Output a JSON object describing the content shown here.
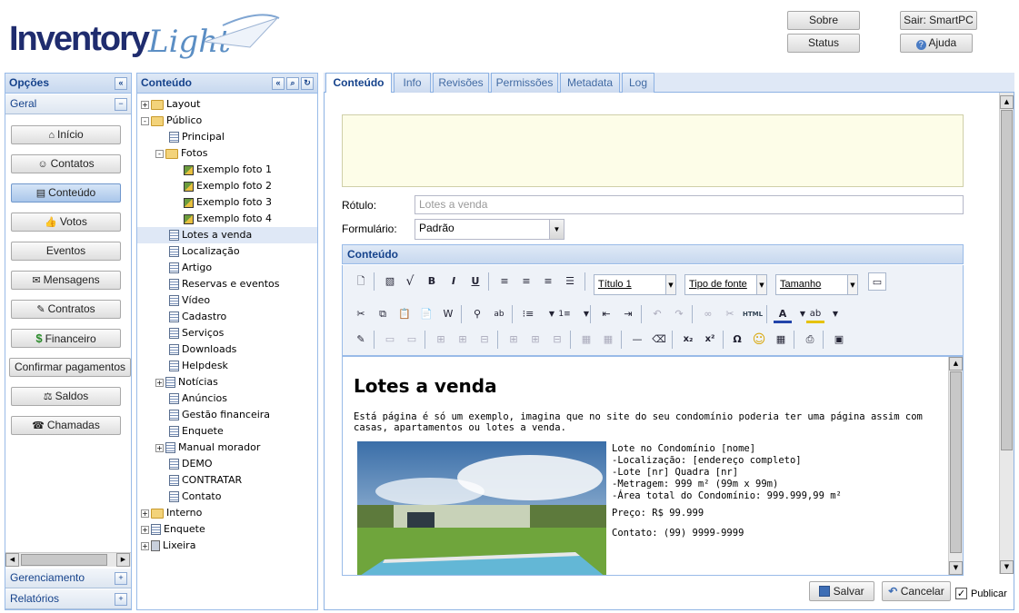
{
  "logo": {
    "part1": "Inventory",
    "part2": "Light"
  },
  "top_buttons": {
    "sobre": "Sobre",
    "status": "Status",
    "sair": "Sair: SmartPC",
    "ajuda": "Ajuda"
  },
  "options_panel": {
    "title": "Opções",
    "group": "Geral",
    "buttons": [
      {
        "label": "Início",
        "icon": "home-icon",
        "glyph": "⌂"
      },
      {
        "label": "Contatos",
        "icon": "contacts-icon",
        "glyph": "☺"
      },
      {
        "label": "Conteúdo",
        "icon": "content-icon",
        "glyph": "▤"
      },
      {
        "label": "Votos",
        "icon": "thumbs-up-icon",
        "glyph": "👍"
      },
      {
        "label": "Eventos",
        "icon": "",
        "glyph": ""
      },
      {
        "label": "Mensagens",
        "icon": "messages-icon",
        "glyph": "✉"
      },
      {
        "label": "Contratos",
        "icon": "contracts-icon",
        "glyph": "✎"
      },
      {
        "label": "Financeiro",
        "icon": "dollar-icon",
        "glyph": "$"
      },
      {
        "label": "Confirmar pagamentos",
        "icon": "",
        "glyph": ""
      },
      {
        "label": "Saldos",
        "icon": "scale-icon",
        "glyph": "⚖"
      },
      {
        "label": "Chamadas",
        "icon": "phone-icon",
        "glyph": "☎"
      }
    ],
    "sections": [
      "Gerenciamento",
      "Relatórios"
    ]
  },
  "tree_panel": {
    "title": "Conteúdo",
    "nodes": [
      {
        "label": "Layout",
        "type": "folder",
        "expander": "+",
        "level": 0
      },
      {
        "label": "Público",
        "type": "folder",
        "expander": "-",
        "level": 0
      },
      {
        "label": "Principal",
        "type": "doc",
        "expander": "",
        "level": 1
      },
      {
        "label": "Fotos",
        "type": "folder",
        "expander": "-",
        "level": 1
      },
      {
        "label": "Exemplo foto 1",
        "type": "img",
        "expander": "",
        "level": 2
      },
      {
        "label": "Exemplo foto 2",
        "type": "img",
        "expander": "",
        "level": 2
      },
      {
        "label": "Exemplo foto 3",
        "type": "img",
        "expander": "",
        "level": 2
      },
      {
        "label": "Exemplo foto 4",
        "type": "img",
        "expander": "",
        "level": 2
      },
      {
        "label": "Lotes a venda",
        "type": "doc",
        "expander": "",
        "level": 1,
        "selected": true
      },
      {
        "label": "Localização",
        "type": "doc",
        "expander": "",
        "level": 1
      },
      {
        "label": "Artigo",
        "type": "doc",
        "expander": "",
        "level": 1
      },
      {
        "label": "Reservas e eventos",
        "type": "doc",
        "expander": "",
        "level": 1
      },
      {
        "label": "Vídeo",
        "type": "doc",
        "expander": "",
        "level": 1
      },
      {
        "label": "Cadastro",
        "type": "doc",
        "expander": "",
        "level": 1
      },
      {
        "label": "Serviços",
        "type": "doc",
        "expander": "",
        "level": 1
      },
      {
        "label": "Downloads",
        "type": "doc",
        "expander": "",
        "level": 1
      },
      {
        "label": "Helpdesk",
        "type": "doc",
        "expander": "",
        "level": 1
      },
      {
        "label": "Notícias",
        "type": "doc",
        "expander": "+",
        "level": 1
      },
      {
        "label": "Anúncios",
        "type": "doc",
        "expander": "",
        "level": 1
      },
      {
        "label": "Gestão financeira",
        "type": "doc",
        "expander": "",
        "level": 1
      },
      {
        "label": "Enquete",
        "type": "doc",
        "expander": "",
        "level": 1
      },
      {
        "label": "Manual morador",
        "type": "doc",
        "expander": "+",
        "level": 1
      },
      {
        "label": "DEMO",
        "type": "doc",
        "expander": "",
        "level": 1
      },
      {
        "label": "CONTRATAR",
        "type": "doc",
        "expander": "",
        "level": 1
      },
      {
        "label": "Contato",
        "type": "doc",
        "expander": "",
        "level": 1
      },
      {
        "label": "Interno",
        "type": "folder",
        "expander": "+",
        "level": 0
      },
      {
        "label": "Enquete",
        "type": "doc",
        "expander": "+",
        "level": 0
      },
      {
        "label": "Lixeira",
        "type": "trash",
        "expander": "+",
        "level": 0
      }
    ]
  },
  "tabs": [
    "Conteúdo",
    "Info",
    "Revisões",
    "Permissões",
    "Metadata",
    "Log"
  ],
  "form": {
    "rotulo_label": "Rótulo:",
    "rotulo_placeholder": "Lotes a venda",
    "formulario_label": "Formulário:",
    "formulario_value": "Padrão",
    "section_title": "Conteúdo"
  },
  "editor": {
    "dropdowns": {
      "format": "Título 1",
      "font": "Tipo de fonte",
      "size": "Tamanho"
    },
    "html_label": "HTML",
    "heading": "Lotes a venda",
    "intro": "Está página é só um exemplo, imagina que no site do seu condomínio poderia ter uma página assim com casas, apartamentos ou lotes a venda.",
    "details": [
      "Lote no Condomínio [nome]",
      "-Localização: [endereço completo]",
      "-Lote [nr] Quadra [nr]",
      "-Metragem: 999 m² (99m x 99m)",
      "-Área total do Condomínio: 999.999,99 m²"
    ],
    "price": "Preço: R$ 99.999",
    "contact": "Contato: (99) 9999-9999"
  },
  "footer": {
    "save": "Salvar",
    "cancel": "Cancelar",
    "publish": "Publicar"
  }
}
